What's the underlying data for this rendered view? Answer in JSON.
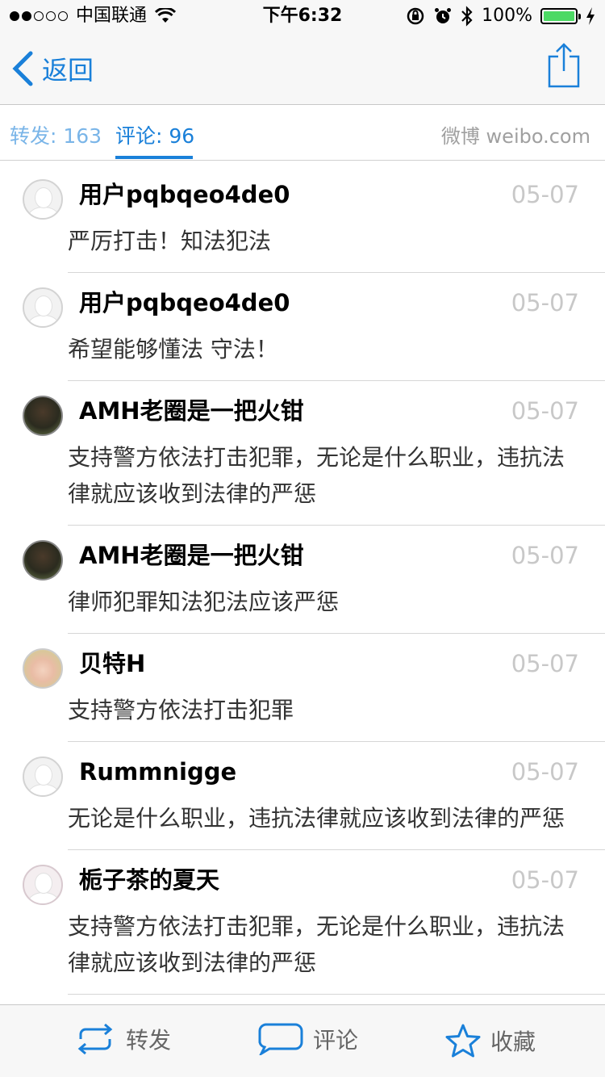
{
  "status_bar": {
    "carrier": "中国联通",
    "time": "下午6:32",
    "battery": "100%"
  },
  "nav": {
    "back_label": "返回"
  },
  "tabs": {
    "repost": "转发: 163",
    "comment": "评论: 96",
    "brand": "微博 weibo.com"
  },
  "comments": [
    {
      "user": "用户pqbqeo4de0",
      "date": "05-07",
      "text": "严厉打击！知法犯法",
      "avatar": "default-avatar"
    },
    {
      "user": "用户pqbqeo4de0",
      "date": "05-07",
      "text": "希望能够懂法 守法！",
      "avatar": "default-avatar"
    },
    {
      "user": "AMH老圈是一把火钳",
      "date": "05-07",
      "text": "支持警方依法打击犯罪，无论是什么职业，违抗法律就应该收到法律的严惩",
      "avatar": "photo-avatar"
    },
    {
      "user": "AMH老圈是一把火钳",
      "date": "05-07",
      "text": "律师犯罪知法犯法应该严惩",
      "avatar": "photo-avatar"
    },
    {
      "user": "贝特H",
      "date": "05-07",
      "text": "支持警方依法打击犯罪",
      "avatar": "photo-avatar"
    },
    {
      "user": "Rummnigge",
      "date": "05-07",
      "text": "无论是什么职业，违抗法律就应该收到法律的严惩",
      "avatar": "default-avatar"
    },
    {
      "user": "栀子茶的夏天",
      "date": "05-07",
      "text": "支持警方依法打击犯罪，无论是什么职业，违抗法律就应该收到法律的严惩",
      "avatar": "default-avatar"
    }
  ],
  "toolbar": {
    "repost": "转发",
    "comment": "评论",
    "favorite": "收藏"
  },
  "colors": {
    "accent": "#1a80d9",
    "battery": "#4cd964",
    "date": "#c8c8c8"
  }
}
